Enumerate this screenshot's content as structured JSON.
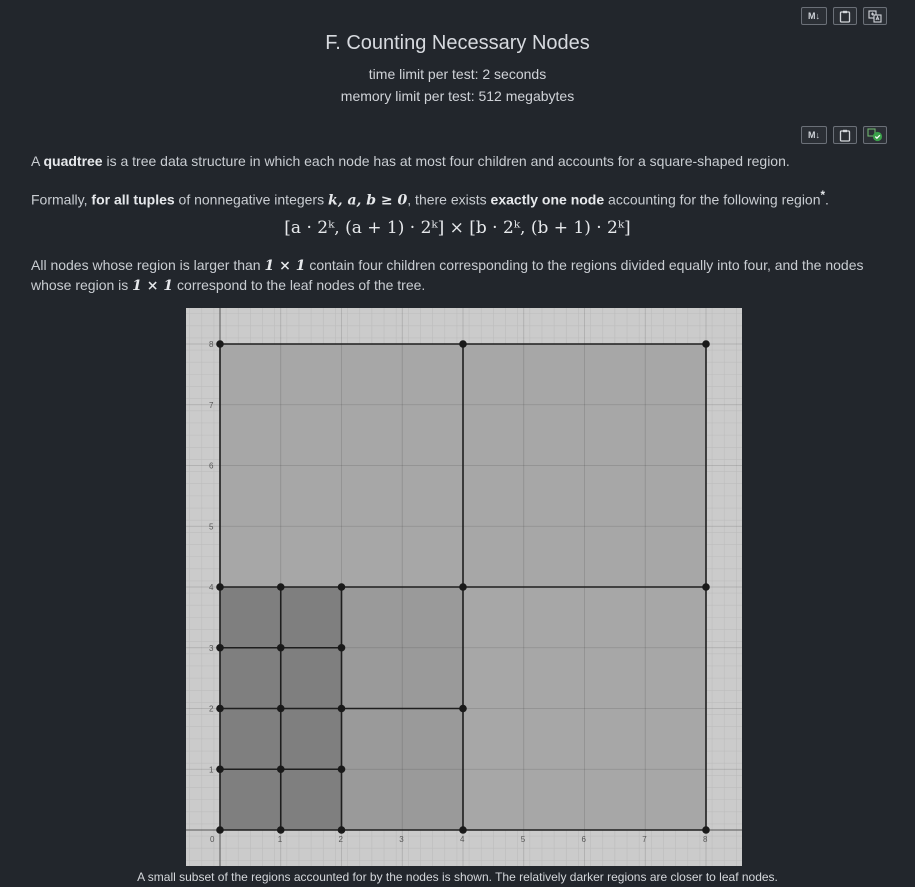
{
  "toolbar_top": {
    "md_label": "M↓",
    "copy_icon": "clipboard-icon",
    "translate_icon": "translate-icon"
  },
  "toolbar_mid": {
    "md_label": "M↓",
    "copy_icon": "clipboard-icon",
    "status_icon": "check-icon"
  },
  "problem": {
    "title": "F. Counting Necessary Nodes",
    "time_limit": "time limit per test: 2 seconds",
    "memory_limit": "memory limit per test: 512 megabytes"
  },
  "statement": {
    "p1_a": "A ",
    "p1_bold": "quadtree",
    "p1_b": " is a tree data structure in which each node has at most four children and accounts for a square-shaped region.",
    "p2_a": "Formally, ",
    "p2_bold1": "for all tuples",
    "p2_b": " of nonnegative integers ",
    "p2_math": "k, a, b ≥ 0",
    "p2_c": ", there exists ",
    "p2_bold2": "exactly one node",
    "p2_d": " accounting for the following region",
    "p2_footnote": "*",
    "p2_end": ".",
    "formula": "[a · 2ᵏ, (a + 1) · 2ᵏ] × [b · 2ᵏ, (b + 1) · 2ᵏ]",
    "p3_a": "All nodes whose region is larger than ",
    "p3_math1": "1 × 1",
    "p3_b": " contain four children corresponding to the regions divided equally into four, and the nodes whose region is ",
    "p3_math2": "1 × 1",
    "p3_c": " correspond to the leaf nodes of the tree."
  },
  "figure": {
    "x_ticks": [
      "0",
      "1",
      "2",
      "3",
      "4",
      "5",
      "6",
      "7",
      "8"
    ],
    "y_ticks": [
      "1",
      "2",
      "3",
      "4",
      "5",
      "6",
      "7",
      "8"
    ],
    "caption": "A small subset of the regions accounted for by the nodes is shown. The relatively darker regions are closer to leaf nodes.",
    "colors": {
      "background": "#cbcbcb",
      "level3": "#a7a7a7",
      "level2": "#9a9a9a",
      "level1": "#8c8c8c",
      "level0": "#7f7f7f",
      "edge": "#1e1e1e"
    },
    "regions": [
      {
        "x": 0,
        "y": 0,
        "size": 8,
        "level": 3
      },
      {
        "x": 0,
        "y": 0,
        "size": 4,
        "level": 2
      },
      {
        "x": 0,
        "y": 0,
        "size": 2,
        "level": 1
      },
      {
        "x": 0,
        "y": 2,
        "size": 2,
        "level": 1
      },
      {
        "x": 0,
        "y": 0,
        "size": 1,
        "level": 0
      },
      {
        "x": 1,
        "y": 0,
        "size": 1,
        "level": 0
      },
      {
        "x": 0,
        "y": 1,
        "size": 1,
        "level": 0
      },
      {
        "x": 1,
        "y": 1,
        "size": 1,
        "level": 0
      },
      {
        "x": 0,
        "y": 2,
        "size": 1,
        "level": 0
      },
      {
        "x": 1,
        "y": 2,
        "size": 1,
        "level": 0
      },
      {
        "x": 0,
        "y": 3,
        "size": 1,
        "level": 0
      },
      {
        "x": 1,
        "y": 3,
        "size": 1,
        "level": 0
      }
    ],
    "lines": [
      {
        "x1": 0,
        "y1": 8,
        "x2": 8,
        "y2": 8
      },
      {
        "x1": 0,
        "y1": 4,
        "x2": 8,
        "y2": 4
      },
      {
        "x1": 0,
        "y1": 0,
        "x2": 8,
        "y2": 0
      },
      {
        "x1": 0,
        "y1": 0,
        "x2": 0,
        "y2": 8
      },
      {
        "x1": 4,
        "y1": 0,
        "x2": 4,
        "y2": 8
      },
      {
        "x1": 8,
        "y1": 0,
        "x2": 8,
        "y2": 8
      },
      {
        "x1": 0,
        "y1": 3,
        "x2": 2,
        "y2": 3
      },
      {
        "x1": 0,
        "y1": 2,
        "x2": 4,
        "y2": 2
      },
      {
        "x1": 0,
        "y1": 1,
        "x2": 2,
        "y2": 1
      },
      {
        "x1": 1,
        "y1": 0,
        "x2": 1,
        "y2": 4
      },
      {
        "x1": 2,
        "y1": 0,
        "x2": 2,
        "y2": 4
      }
    ],
    "points": [
      [
        0,
        8
      ],
      [
        4,
        8
      ],
      [
        8,
        8
      ],
      [
        0,
        4
      ],
      [
        1,
        4
      ],
      [
        2,
        4
      ],
      [
        4,
        4
      ],
      [
        8,
        4
      ],
      [
        0,
        3
      ],
      [
        1,
        3
      ],
      [
        2,
        3
      ],
      [
        0,
        2
      ],
      [
        1,
        2
      ],
      [
        2,
        2
      ],
      [
        4,
        2
      ],
      [
        0,
        1
      ],
      [
        1,
        1
      ],
      [
        2,
        1
      ],
      [
        0,
        0
      ],
      [
        1,
        0
      ],
      [
        2,
        0
      ],
      [
        4,
        0
      ],
      [
        8,
        0
      ]
    ]
  }
}
